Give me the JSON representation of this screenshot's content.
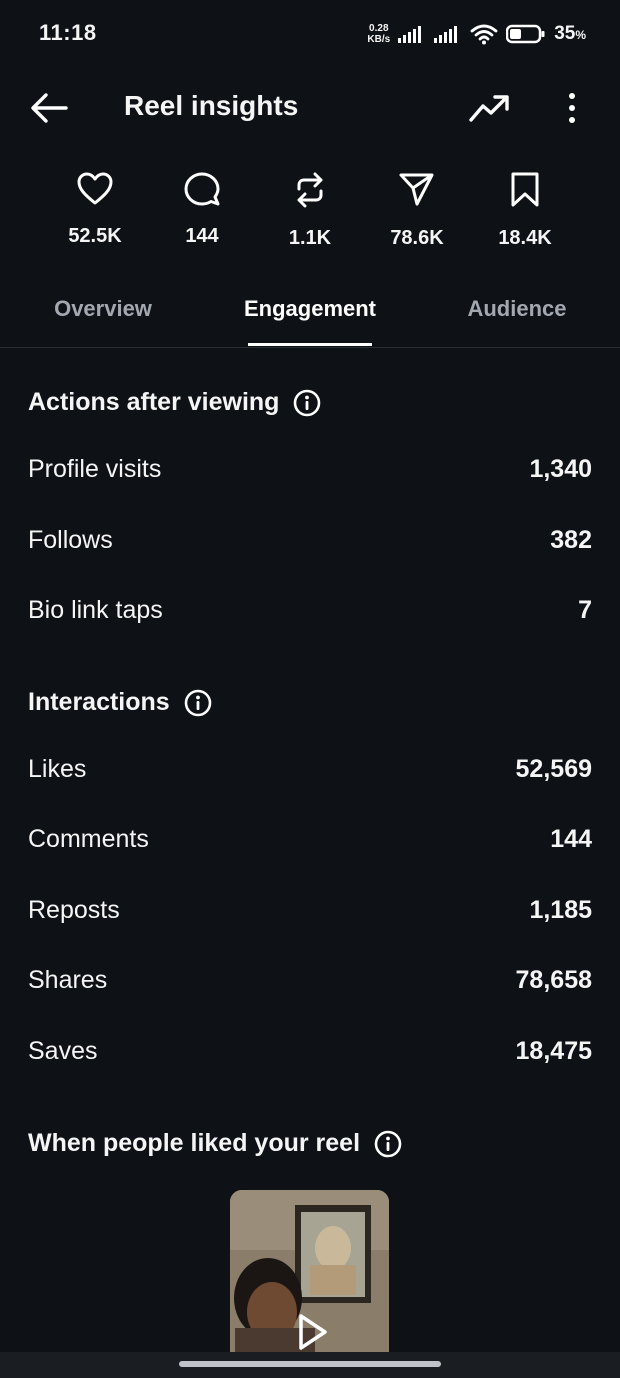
{
  "status_bar": {
    "time": "11:18",
    "net_speed_value": "0.28",
    "net_speed_unit": "KB/s",
    "battery_percent": "35",
    "battery_percent_sign": "%"
  },
  "app_bar": {
    "title": "Reel insights",
    "icons": [
      "arrow-left-icon",
      "trending-up-icon",
      "more-vertical-icon"
    ]
  },
  "metrics": [
    {
      "icon": "heart-icon",
      "value": "52.5K"
    },
    {
      "icon": "comment-icon",
      "value": "144"
    },
    {
      "icon": "repost-icon",
      "value": "1.1K"
    },
    {
      "icon": "send-icon",
      "value": "78.6K"
    },
    {
      "icon": "bookmark-icon",
      "value": "18.4K"
    }
  ],
  "tabs": [
    {
      "label": "Overview",
      "active": false
    },
    {
      "label": "Engagement",
      "active": true
    },
    {
      "label": "Audience",
      "active": false
    }
  ],
  "actions_section": {
    "title": "Actions after viewing",
    "rows": [
      {
        "label": "Profile visits",
        "value": "1,340"
      },
      {
        "label": "Follows",
        "value": "382"
      },
      {
        "label": "Bio link taps",
        "value": "7"
      }
    ]
  },
  "interactions_section": {
    "title": "Interactions",
    "rows": [
      {
        "label": "Likes",
        "value": "52,569"
      },
      {
        "label": "Comments",
        "value": "144"
      },
      {
        "label": "Reposts",
        "value": "1,185"
      },
      {
        "label": "Shares",
        "value": "78,658"
      },
      {
        "label": "Saves",
        "value": "18,475"
      }
    ]
  },
  "liked_section": {
    "title": "When people liked your reel"
  },
  "colors": {
    "background": "#0e1116",
    "text": "#f5f5f5",
    "muted": "#a3a8b0"
  }
}
